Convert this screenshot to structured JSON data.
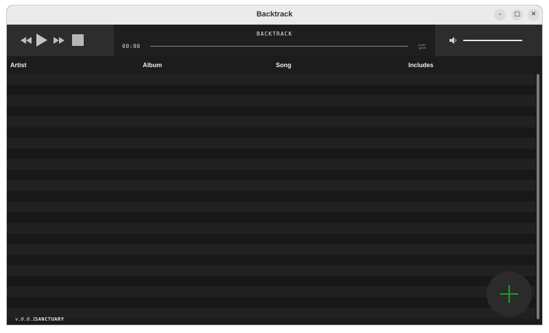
{
  "window": {
    "title": "Backtrack",
    "minimize_glyph": "–",
    "maximize_glyph": "□",
    "close_glyph": "✕"
  },
  "player": {
    "now_playing": "BACKTRACK",
    "time": "00:00",
    "progress_fraction": 0,
    "volume_fraction": 1.0,
    "icons": {
      "rewind": "rewind-icon",
      "play": "play-icon",
      "fast_forward": "fast-forward-icon",
      "stop": "stop-icon",
      "repeat": "repeat-icon",
      "volume": "speaker-icon"
    }
  },
  "table": {
    "columns": [
      "Artist",
      "Album",
      "Song",
      "Includes"
    ],
    "rows": []
  },
  "footer": {
    "version": "v.0.0.1",
    "app_name": "SANCTUARY"
  },
  "colors": {
    "background": "#1b1b1b",
    "accent": "#1fa21f"
  },
  "fab_icon": "plus-icon"
}
